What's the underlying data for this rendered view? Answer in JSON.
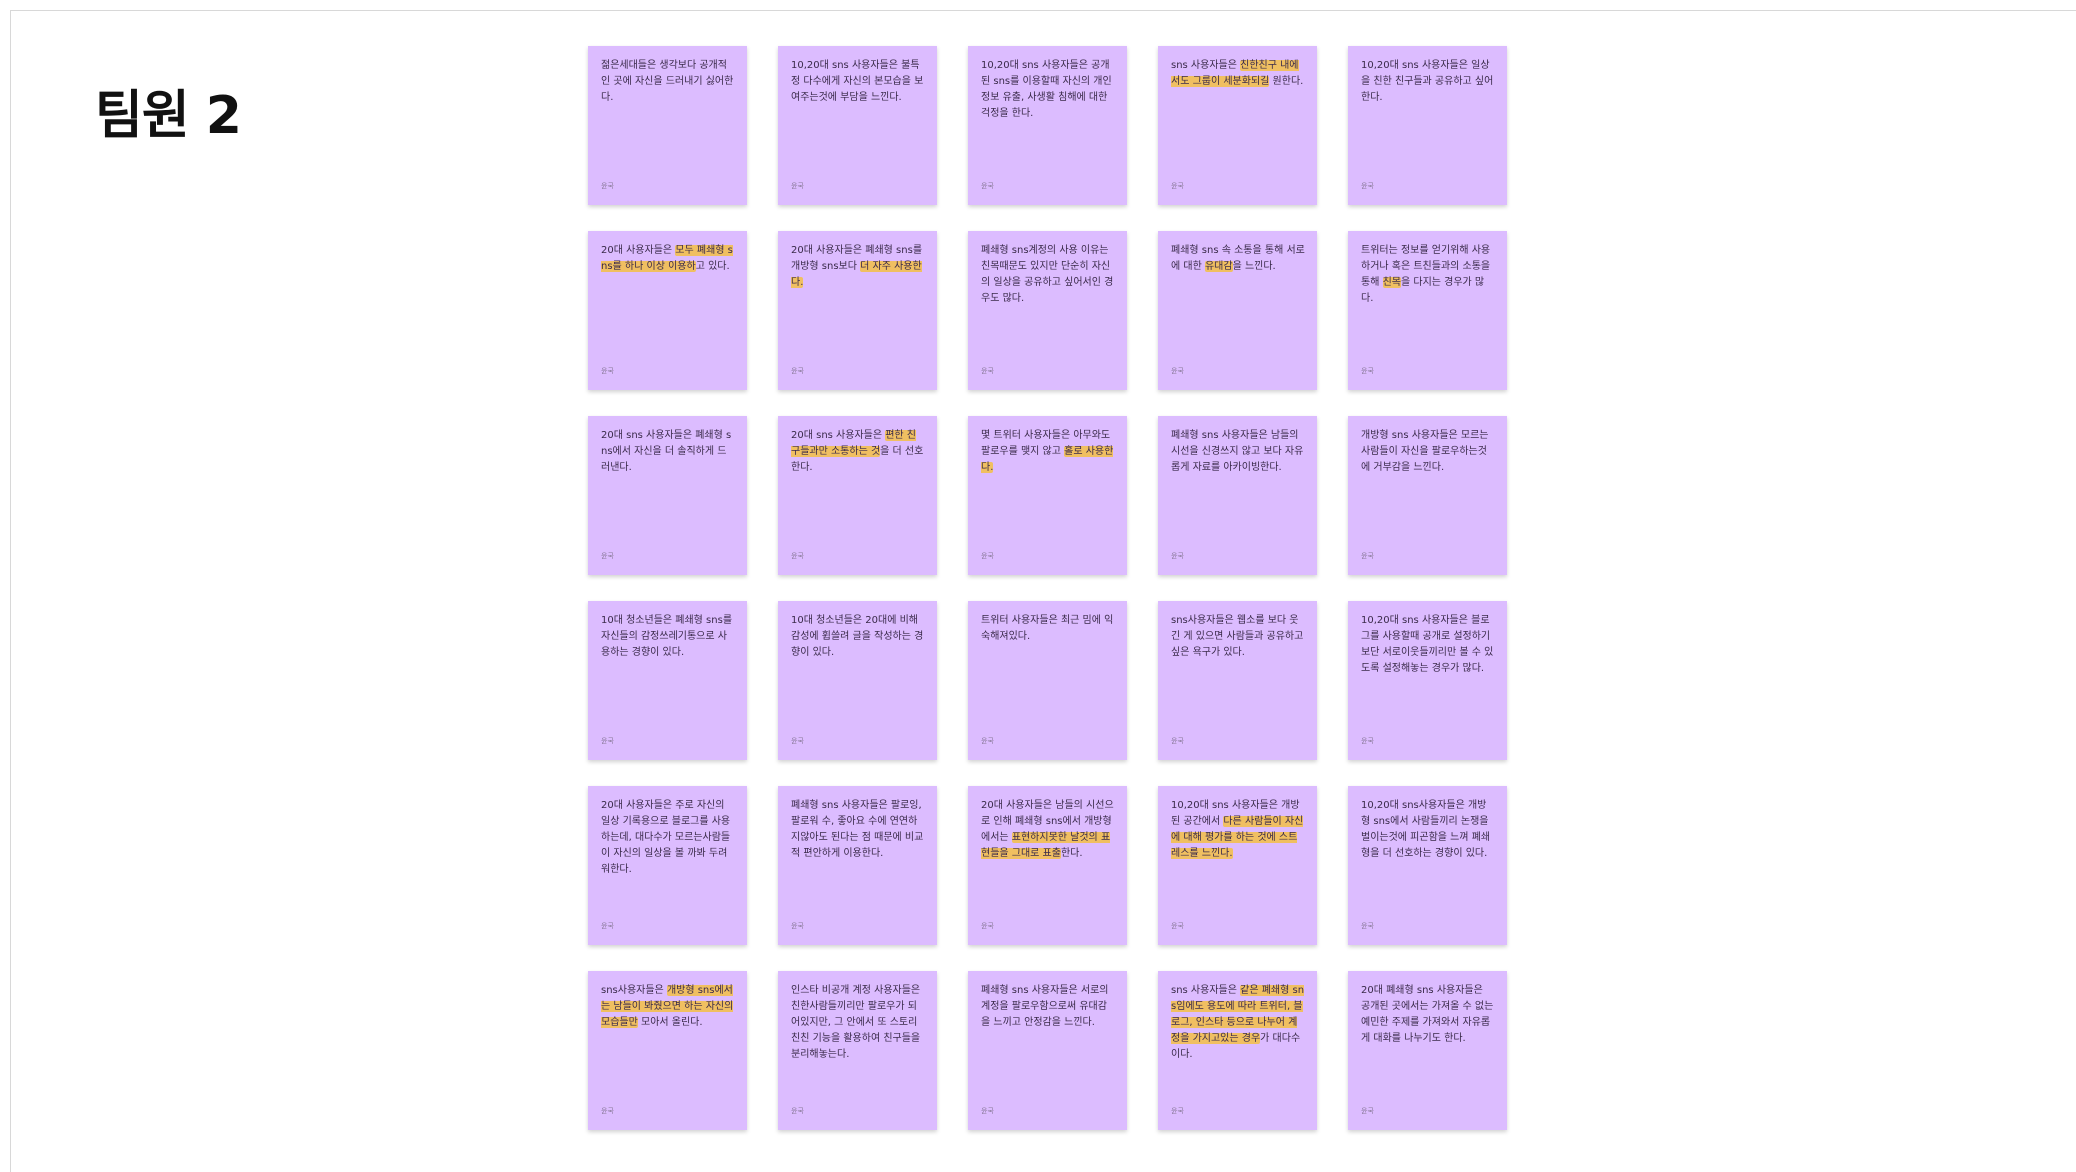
{
  "title": "팀원 2",
  "colors": {
    "note": "#dcbcff",
    "highlight": "#f0bf61"
  },
  "notes": [
    {
      "segments": [
        {
          "t": "젊은세대들은 생각보다 공개적인 곳에 자신을 드러내기 싫어한다."
        }
      ],
      "author": "윤국"
    },
    {
      "segments": [
        {
          "t": "10,20대 sns 사용자들은 불특정 다수에게 자신의 본모습을 보여주는것에 부담을 느낀다."
        }
      ],
      "author": "윤국"
    },
    {
      "segments": [
        {
          "t": "10,20대 sns 사용자들은 공개된 sns를 이용할때 자신의 개인정보 유출, 사생활 침해에 대한 걱정을 한다."
        }
      ],
      "author": "윤국"
    },
    {
      "segments": [
        {
          "t": "sns 사용자들은 "
        },
        {
          "t": "친한친구 내에서도 그룹이 세분화되길",
          "h": true
        },
        {
          "t": " 원한다."
        }
      ],
      "author": "윤국"
    },
    {
      "segments": [
        {
          "t": "10,20대 sns 사용자들은 일상을 친한 친구들과 공유하고 싶어한다."
        }
      ],
      "author": "윤국"
    },
    {
      "segments": [
        {
          "t": "20대 사용자들은 "
        },
        {
          "t": "모두 폐쇄형 sns를 하나 이상 이용하",
          "h": true
        },
        {
          "t": "고 있다."
        }
      ],
      "author": "윤국"
    },
    {
      "segments": [
        {
          "t": "20대 사용자들은 폐쇄형 sns를 개방형 sns보다 "
        },
        {
          "t": "더 자주 사용한다.",
          "h": true
        }
      ],
      "author": "윤국"
    },
    {
      "segments": [
        {
          "t": "폐쇄형 sns계정의 사용 이유는 친목때문도 있지만 단순히 자신의 일상을 공유하고 싶어서인 경우도 많다."
        }
      ],
      "author": "윤국"
    },
    {
      "segments": [
        {
          "t": "폐쇄형 sns 속 소통을 통해 서로에 대한 "
        },
        {
          "t": "유대감",
          "h": true
        },
        {
          "t": "을 느낀다."
        }
      ],
      "author": "윤국"
    },
    {
      "segments": [
        {
          "t": "트위터는 정보를 얻기위해 사용하거나 혹은 트친들과의 소통을 통해 "
        },
        {
          "t": "친목",
          "h": true
        },
        {
          "t": "을 다지는 경우가 많다."
        }
      ],
      "author": "윤국"
    },
    {
      "segments": [
        {
          "t": "20대 sns 사용자들은 폐쇄형 sns에서 자신을 더 솔직하게 드러낸다."
        }
      ],
      "author": "윤국"
    },
    {
      "segments": [
        {
          "t": "20대 sns 사용자들은 "
        },
        {
          "t": "편한 친구들과만 소통하는 것",
          "h": true
        },
        {
          "t": "을 더 선호한다."
        }
      ],
      "author": "윤국"
    },
    {
      "segments": [
        {
          "t": "몇 트위터 사용자들은 아무와도 팔로우를 맺지 않고 "
        },
        {
          "t": "홀로 사용한다.",
          "h": true
        }
      ],
      "author": "윤국"
    },
    {
      "segments": [
        {
          "t": "폐쇄형 sns 사용자들은 남들의 시선을 신경쓰지 않고 보다 자유롭게 자료를 아카이빙한다."
        }
      ],
      "author": "윤국"
    },
    {
      "segments": [
        {
          "t": "개방형 sns 사용자들은 모르는 사람들이 자신을 팔로우하는것에 거부감을 느낀다."
        }
      ],
      "author": "윤국"
    },
    {
      "segments": [
        {
          "t": "10대 청소년들은 폐쇄형 sns를 자신들의 감정쓰레기통으로 사용하는 경향이 있다."
        }
      ],
      "author": "윤국"
    },
    {
      "segments": [
        {
          "t": "10대 청소년들은 20대에 비해 감성에 휩쓸려 글을 작성하는 경향이 있다."
        }
      ],
      "author": "윤국"
    },
    {
      "segments": [
        {
          "t": "트위터 사용자들은 최근 밈에 익숙해져있다."
        }
      ],
      "author": "윤국"
    },
    {
      "segments": [
        {
          "t": "sns사용자들은 웹소를 보다 웃긴 게 있으면 사람들과 공유하고 싶은 욕구가 있다."
        }
      ],
      "author": "윤국"
    },
    {
      "segments": [
        {
          "t": "10,20대 sns 사용자들은 블로그를 사용할때 공개로 설정하기보단 서로이웃들끼리만 볼 수 있도록 설정해놓는 경우가 많다."
        }
      ],
      "author": "윤국"
    },
    {
      "segments": [
        {
          "t": "20대 사용자들은 주로 자신의 일상 기록용으로 블로그를 사용하는데, 대다수가 모르는사람들이 자신의 일상을 볼 까봐 두려워한다."
        }
      ],
      "author": "윤국"
    },
    {
      "segments": [
        {
          "t": "폐쇄형 sns 사용자들은 팔로잉, 팔로워 수, 좋아요 수에 연연하지않아도 된다는 점 때문에 비교적 편안하게 이용한다."
        }
      ],
      "author": "윤국"
    },
    {
      "segments": [
        {
          "t": "20대 사용자들은 남들의 시선으로 인해 폐쇄형 sns에서 개방형에서는 "
        },
        {
          "t": "표현하지못한 날것의 표현들을 그대로 표출",
          "h": true
        },
        {
          "t": "한다."
        }
      ],
      "author": "윤국"
    },
    {
      "segments": [
        {
          "t": "10,20대 sns 사용자들은 개방된 공간에서 "
        },
        {
          "t": "다른 사람들이 자신에 대해 평가를 하는 것에 스트레스를 느낀다.",
          "h": true
        }
      ],
      "author": "윤국"
    },
    {
      "segments": [
        {
          "t": "10,20대 sns사용자들은 개방형 sns에서 사람들끼리 논쟁을 벌이는것에 피곤함을 느껴 폐쇄형을 더 선호하는 경향이 있다."
        }
      ],
      "author": "윤국"
    },
    {
      "segments": [
        {
          "t": "sns사용자들은 "
        },
        {
          "t": "개방형 sns에서는 남들이 봐줬으면 하는 자신의 모습들만",
          "h": true
        },
        {
          "t": " 모아서 올린다."
        }
      ],
      "author": "윤국"
    },
    {
      "segments": [
        {
          "t": "인스타 비공개 계정 사용자들은 친한사람들끼리만 팔로우가 되어있지만, 그 안에서 또 스토리 친친 기능을 활용하여 친구들을 분리해놓는다."
        }
      ],
      "author": "윤국"
    },
    {
      "segments": [
        {
          "t": "폐쇄형 sns 사용자들은 서로의 계정을 팔로우함으로써 유대감을 느끼고 안정감을 느낀다."
        }
      ],
      "author": "윤국"
    },
    {
      "segments": [
        {
          "t": "sns 사용자들은 "
        },
        {
          "t": "같은 폐쇄형 sns임에도 용도에 따라 트위터, 블로그, 인스타 등으로 나누어 계정을 가지고있는 경우",
          "h": true
        },
        {
          "t": "가 대다수이다."
        }
      ],
      "author": "윤국"
    },
    {
      "segments": [
        {
          "t": "20대 폐쇄형 sns 사용자들은 공개된 곳에서는 가져올 수 없는 예민한 주제를 가져와서 자유롭게 대화를 나누기도 한다."
        }
      ],
      "author": "윤국"
    }
  ]
}
